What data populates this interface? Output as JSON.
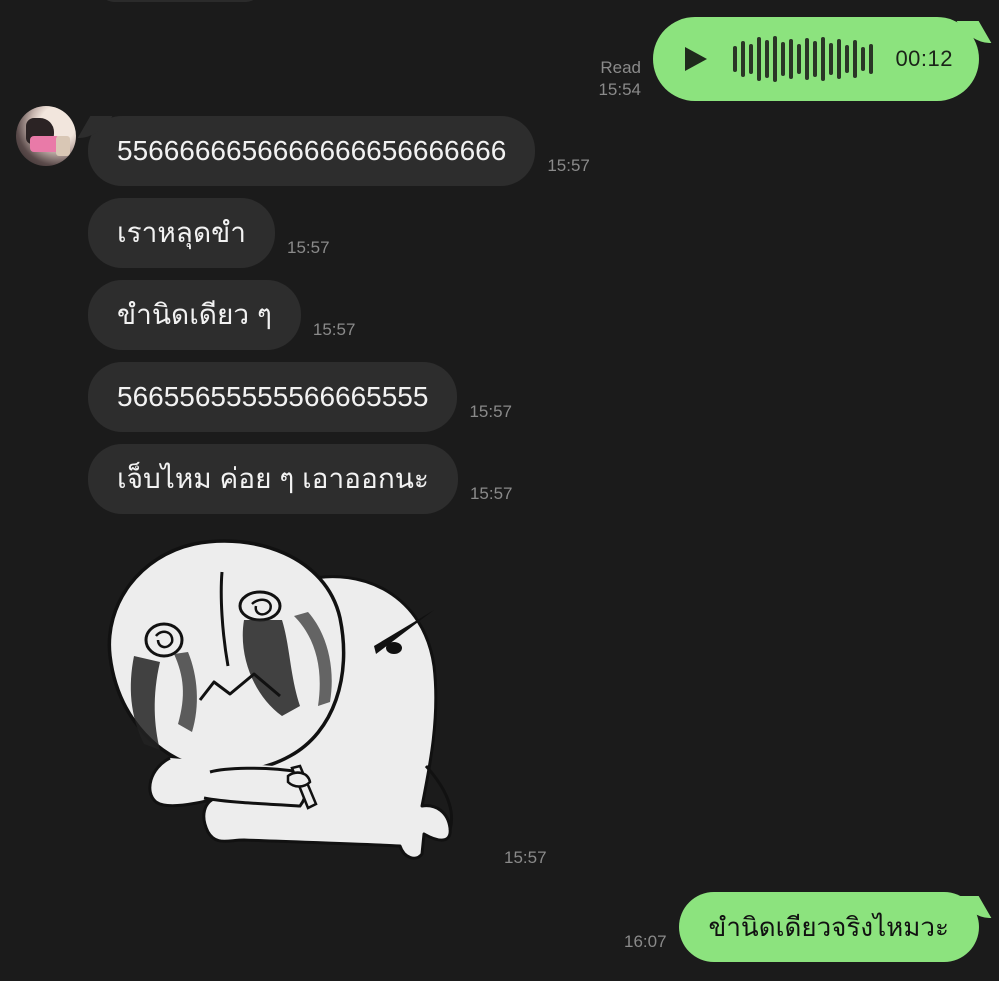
{
  "colors": {
    "background": "#1b1b1b",
    "incoming_bubble": "#2d2d2d",
    "outgoing_bubble": "#8ce37e",
    "timestamp": "#8a8a8a"
  },
  "voice_message": {
    "read_label": "Read",
    "time": "15:54",
    "duration": "00:12",
    "play_icon": "play-icon"
  },
  "incoming_messages": [
    {
      "text": "5566666656666666656666666",
      "time": "15:57"
    },
    {
      "text": "เราหลุดขำ",
      "time": "15:57"
    },
    {
      "text": "ขำนิดเดียว ๆ",
      "time": "15:57"
    },
    {
      "text": "56655655555566665555",
      "time": "15:57"
    },
    {
      "text": "เจ็บไหม ค่อย ๆ เอาออกนะ",
      "time": "15:57"
    }
  ],
  "sticker": {
    "time": "15:57"
  },
  "outgoing_message": {
    "text": "ขำนิดเดียวจริงไหมวะ",
    "time": "16:07"
  }
}
